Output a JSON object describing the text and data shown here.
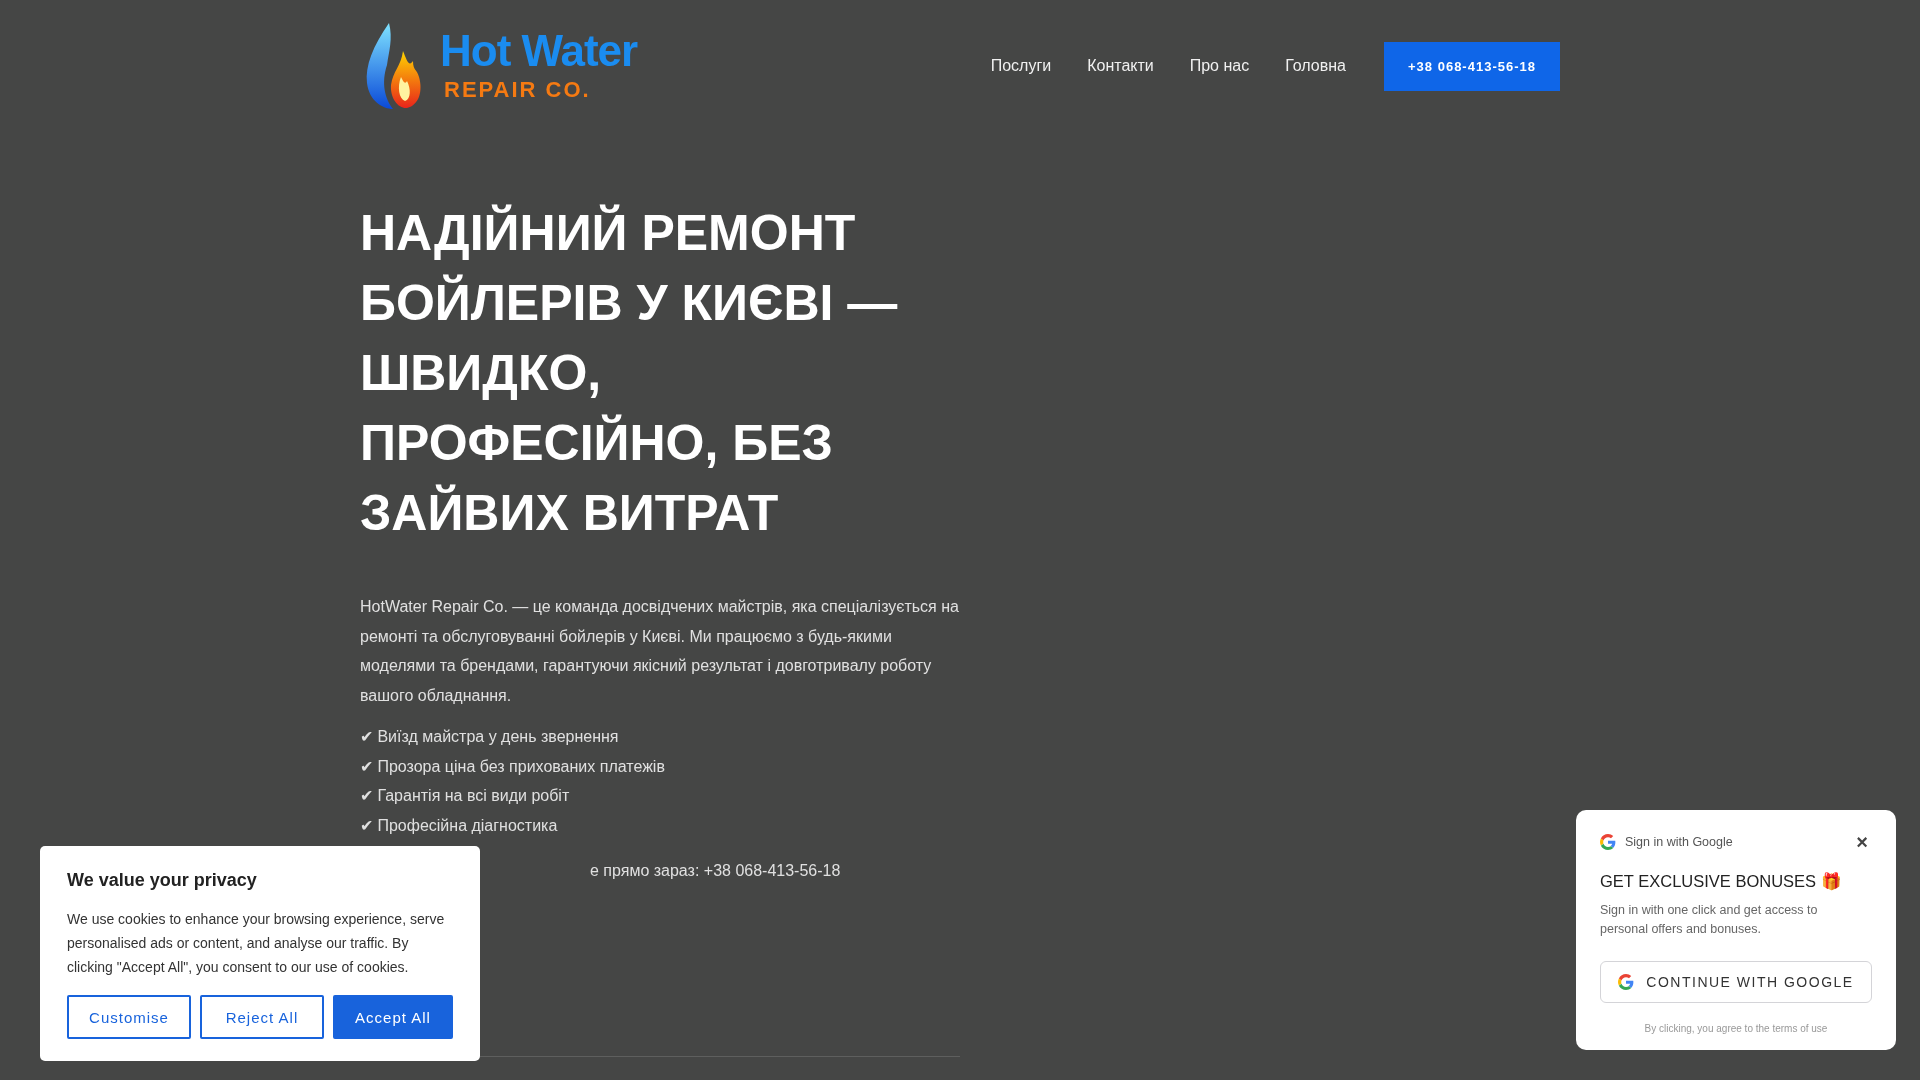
{
  "header": {
    "logo": {
      "line_1": "Hot Water",
      "line_2": "REPAIR CO."
    },
    "nav": [
      {
        "label": "Послуги"
      },
      {
        "label": "Контакти"
      },
      {
        "label": "Про нас"
      },
      {
        "label": "Головна"
      }
    ],
    "phone_button": "+38 068-413-56-18"
  },
  "hero": {
    "title": "НАДІЙНИЙ РЕМОНТ БОЙЛЕРІВ У КИЄВІ — ШВИДКО, ПРОФЕСІЙНО, БЕЗ ЗАЙВИХ ВИТРАТ",
    "intro": "HotWater Repair Co. — це команда досвідчених майстрів, яка спеціалізується на ремонті та обслуговуванні бойлерів у Києві. Ми працюємо з будь-якими моделями та брендами, гарантуючи якісний результат і довготривалу роботу вашого обладнання.",
    "features": [
      {
        "mark": "✔",
        "text": "Виїзд майстра у день звернення"
      },
      {
        "mark": "✔",
        "text": "Прозора ціна без прихованих платежів"
      },
      {
        "mark": "✔",
        "text": "Гарантія на всі види робіт"
      },
      {
        "mark": "✔",
        "text": "Професійна діагностика"
      }
    ],
    "call_line": "е прямо зараз: +38 068-413-56-18"
  },
  "cookie_banner": {
    "title": "We value your privacy",
    "text": "We use cookies to enhance your browsing experience, serve personalised ads or content, and analyse our traffic. By clicking \"Accept All\", you consent to our use of cookies.",
    "buttons": [
      {
        "label": "Customise",
        "kind": "outline"
      },
      {
        "label": "Reject All",
        "kind": "outline"
      },
      {
        "label": "Accept All",
        "kind": "primary"
      }
    ]
  },
  "google_popup": {
    "header": "Sign in with Google",
    "close": "×",
    "title": "GET EXCLUSIVE BONUSES 🎁",
    "text": "Sign in with one click and get access to personal offers and bonuses.",
    "button": "CONTINUE WITH GOOGLE",
    "terms": "By clicking, you agree to the terms of use"
  }
}
